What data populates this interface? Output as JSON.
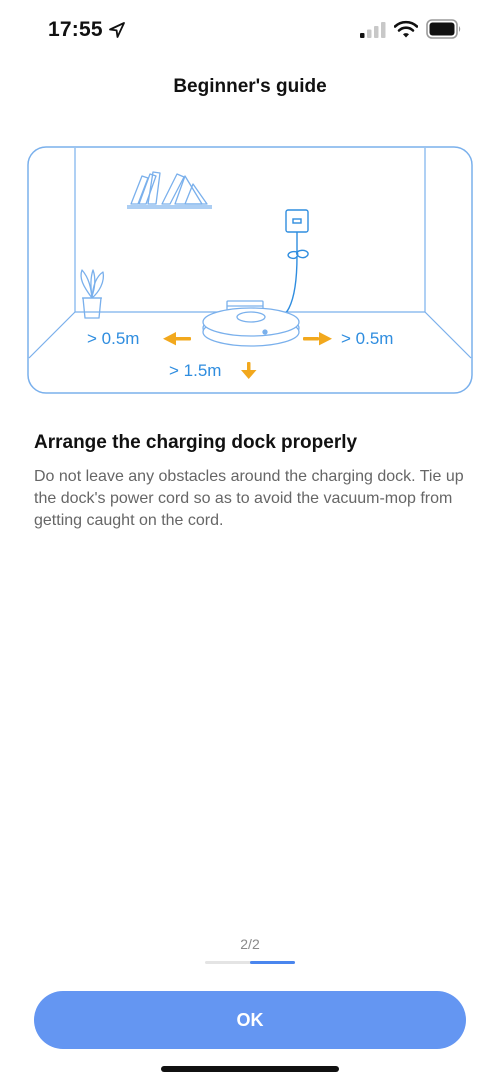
{
  "status_bar": {
    "time": "17:55",
    "icons": [
      "location-arrow-icon",
      "cellular-signal-icon",
      "wifi-icon",
      "battery-icon"
    ]
  },
  "header": {
    "title": "Beginner's guide"
  },
  "illustration": {
    "labels": {
      "left_clearance": "> 0.5m",
      "right_clearance": "> 0.5m",
      "front_clearance": "> 1.5m"
    },
    "colors": {
      "line": "#6aa6e8",
      "arrow": "#f2a81d",
      "text": "#2f8ddf"
    }
  },
  "content": {
    "heading": "Arrange the charging dock properly",
    "body": "Do not leave any obstacles around the charging dock. Tie up the dock's power cord so as to avoid the vacuum-mop from getting caught on the cord."
  },
  "pager": {
    "label": "2/2",
    "current": 2,
    "total": 2
  },
  "footer": {
    "ok_label": "OK"
  },
  "colors": {
    "accent": "#6496f2",
    "progress_active": "#4a86ee"
  }
}
